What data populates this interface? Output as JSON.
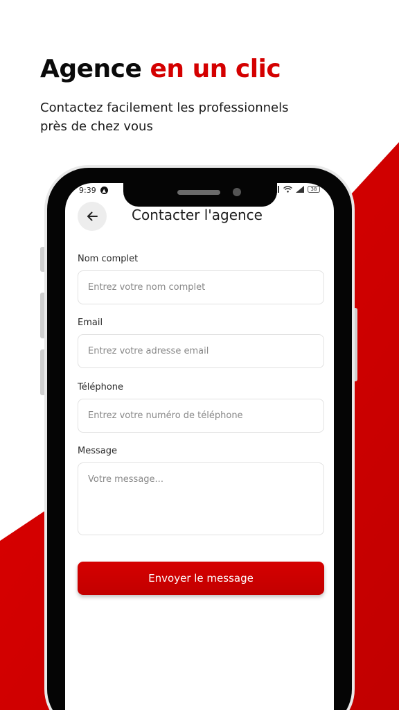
{
  "hero": {
    "title_part1": "Agence",
    "title_part2": "en un clic",
    "subtitle": "Contactez facilement les professionnels près de chez vous"
  },
  "status_bar": {
    "time": "9:39",
    "battery": "38"
  },
  "screen": {
    "title": "Contacter l'agence",
    "back_icon": "arrow-left-icon"
  },
  "form": {
    "fields": [
      {
        "label": "Nom complet",
        "placeholder": "Entrez votre nom complet"
      },
      {
        "label": "Email",
        "placeholder": "Entrez votre adresse email"
      },
      {
        "label": "Téléphone",
        "placeholder": "Entrez votre numéro de téléphone"
      },
      {
        "label": "Message",
        "placeholder": "Votre message..."
      }
    ],
    "submit_label": "Envoyer le message"
  },
  "colors": {
    "accent": "#d40000",
    "button": "#c90000"
  }
}
